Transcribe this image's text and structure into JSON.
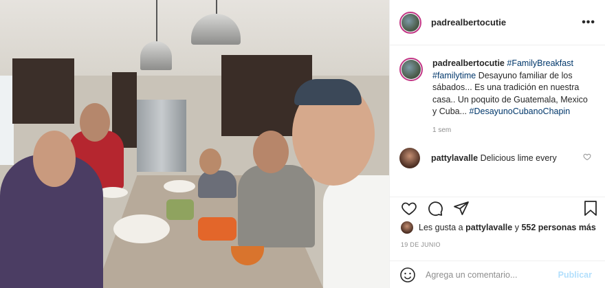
{
  "post": {
    "image_alt": "",
    "username": "padrealbertocutie",
    "more_label": "•••"
  },
  "caption": {
    "username": "padrealbertocutie",
    "tags_line1": "#FamilyBreakfast",
    "tags_line2": "#familytime",
    "text": "Desayuno familiar de los sábados... Es una tradición en nuestra casa.. Un poquito de Guatemala, Mexico y Cuba...",
    "tag_end": "#DesayunoCubanoChapin",
    "time": "1 sem"
  },
  "comments": [
    {
      "username": "pattylavalle",
      "text": "Delicious lime every"
    }
  ],
  "likes": {
    "prefix": "Les gusta a",
    "user": "pattylavalle",
    "middle": "y",
    "count": "552 personas más"
  },
  "date": "19 DE JUNIO",
  "compose": {
    "placeholder": "Agrega un comentario...",
    "publish_label": "Publicar"
  },
  "icons": {
    "like": "heart-icon",
    "comment": "comment-icon",
    "share": "share-icon",
    "save": "bookmark-icon",
    "emoji": "emoji-icon",
    "more": "more-icon"
  },
  "colors": {
    "link": "#00376b",
    "publish_disabled": "#b2dffc",
    "story_ring": "#c13584"
  }
}
